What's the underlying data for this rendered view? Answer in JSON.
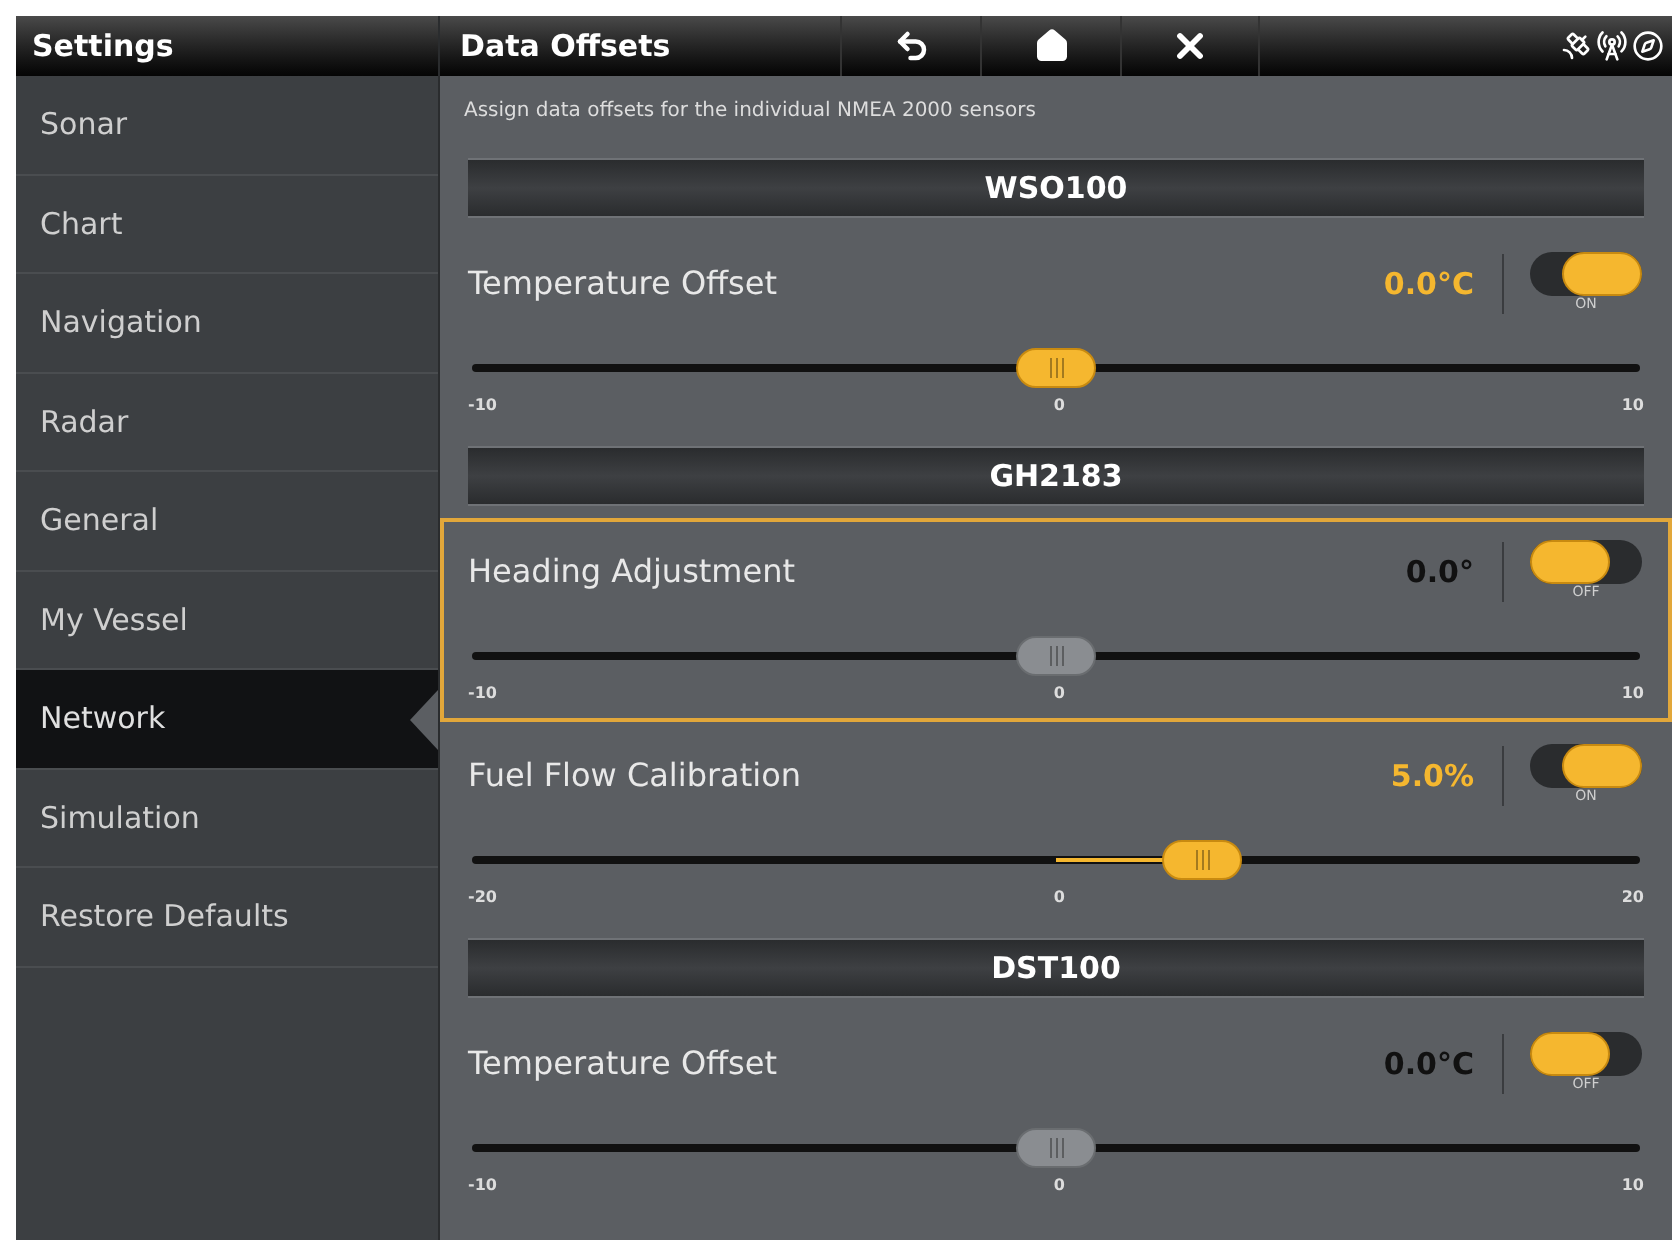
{
  "sidebar": {
    "title": "Settings",
    "items": [
      {
        "label": "Sonar",
        "selected": false
      },
      {
        "label": "Chart",
        "selected": false
      },
      {
        "label": "Navigation",
        "selected": false
      },
      {
        "label": "Radar",
        "selected": false
      },
      {
        "label": "General",
        "selected": false
      },
      {
        "label": "My Vessel",
        "selected": false
      },
      {
        "label": "Network",
        "selected": true
      },
      {
        "label": "Simulation",
        "selected": false
      },
      {
        "label": "Restore Defaults",
        "selected": false
      }
    ]
  },
  "page": {
    "title": "Data Offsets",
    "description": "Assign data offsets for the individual NMEA 2000 sensors"
  },
  "sections": [
    {
      "title": "WSO100",
      "settings": [
        {
          "name": "Temperature Offset",
          "value": "0.0°C",
          "on": true,
          "focused": false,
          "toggle_label": "ON",
          "level": 0.5,
          "min": "-10",
          "mid": "0",
          "max": "10"
        }
      ]
    },
    {
      "title": "GH2183",
      "settings": [
        {
          "name": "Heading Adjustment",
          "value": "0.0°",
          "on": false,
          "focused": true,
          "toggle_label": "OFF",
          "level": 0.5,
          "min": "-10",
          "mid": "0",
          "max": "10"
        },
        {
          "name": "Fuel Flow Calibration",
          "value": "5.0%",
          "on": true,
          "focused": false,
          "toggle_label": "ON",
          "level": 0.625,
          "min": "-20",
          "mid": "0",
          "max": "20"
        }
      ]
    },
    {
      "title": "DST100",
      "settings": [
        {
          "name": "Temperature Offset",
          "value": "0.0°C",
          "on": false,
          "focused": false,
          "toggle_label": "OFF",
          "level": 0.5,
          "min": "-10",
          "mid": "0",
          "max": "10"
        }
      ]
    }
  ]
}
